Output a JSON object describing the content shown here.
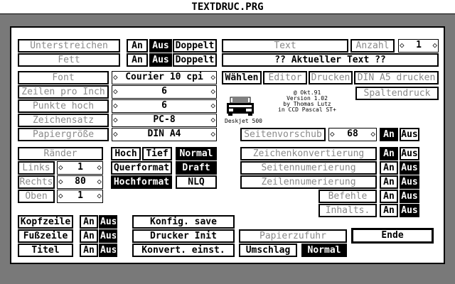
{
  "window": {
    "title": "TEXTDRUC.PRG"
  },
  "rows": {
    "unterstreichen": {
      "label": "Unterstreichen",
      "an": "An",
      "aus": "Aus",
      "doppelt": "Doppelt"
    },
    "fett": {
      "label": "Fett",
      "an": "An",
      "aus": "Aus",
      "doppelt": "Doppelt"
    }
  },
  "text": {
    "label": "Text",
    "anzahl_label": "Anzahl",
    "anzahl_value": "1",
    "current": "?? Aktueller Text ??"
  },
  "settings": {
    "font_label": "Font",
    "font_value": "Courier 10 cpi",
    "zeilen_label": "Zeilen pro Inch",
    "zeilen_value": "6",
    "punkte_label": "Punkte hoch",
    "punkte_value": "6",
    "zeichensatz_label": "Zeichensatz",
    "zeichensatz_value": "PC-8",
    "papier_label": "Papiergröße",
    "papier_value": "DIN A4"
  },
  "actions": {
    "waehlen": "Wählen",
    "editor": "Editor",
    "drucken": "Drucken",
    "din_a5": "DIN A5 drucken",
    "spaltendruck": "Spaltendruck"
  },
  "info": {
    "line1": "@ Okt.91",
    "line2": "Version 1.02",
    "line3": "by Thomas Lutz",
    "line4": "in CCD Pascal ST+",
    "printer": "Deskjet 500"
  },
  "seitenvorschub": {
    "label": "Seitenvorschub",
    "value": "68",
    "an": "An",
    "aus": "Aus"
  },
  "raender": {
    "label": "Ränder",
    "links_label": "Links",
    "links_value": "1",
    "rechts_label": "Rechts",
    "rechts_value": "80",
    "oben_label": "Oben",
    "oben_value": "1"
  },
  "format": {
    "hoch": "Hoch",
    "tief": "Tief",
    "normal": "Normal",
    "querformat": "Querformat",
    "draft": "Draft",
    "hochformat": "Hochformat",
    "nlq": "NLQ"
  },
  "options": {
    "zeichenkonvertierung": "Zeichenkonvertierung",
    "seitennumerierung": "Seitennumerierung",
    "zeilennumerierung": "Zeilennumerierung",
    "befehle": "Befehle",
    "inhalts": "Inhalts.",
    "an": "An",
    "aus": "Aus"
  },
  "header_footer": {
    "kopfzeile": "Kopfzeile",
    "fusszeile": "Fußzeile",
    "titel": "Titel",
    "an": "An",
    "aus": "Aus"
  },
  "bottom": {
    "konfig_save": "Konfig. save",
    "drucker_init": "Drucker Init",
    "konvert_einst": "Konvert. einst.",
    "papierzufuhr": "Papierzufuhr",
    "ende": "Ende",
    "umschlag": "Umschlag",
    "normal": "Normal"
  },
  "icons": {
    "arrow_left": "◇",
    "arrow_right": "◇"
  }
}
